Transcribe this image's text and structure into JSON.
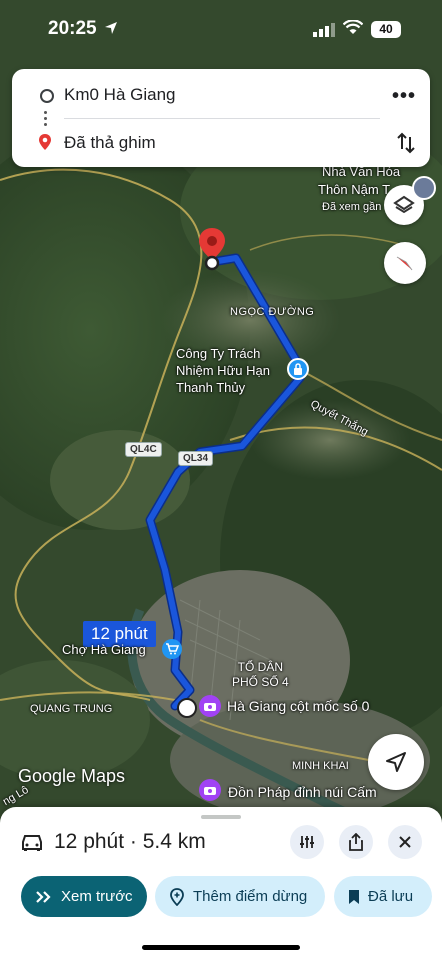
{
  "status_bar": {
    "time": "20:25",
    "battery": "40"
  },
  "directions": {
    "origin": "Km0 Hà Giang",
    "destination": "Đã thả ghim"
  },
  "map": {
    "labels": {
      "nha_van_hoa": "Nhà Văn Hóa",
      "thon_nam": "Thôn Nậm T",
      "da_xem_gan": "Đã xem gần",
      "ngoc_duong": "NGỌC ĐƯỜNG",
      "company_line1": "Công Ty Trách",
      "company_line2": "Nhiệm Hữu Hạn",
      "company_line3": "Thanh Thủy",
      "quyet_thang": "Quyết Thắng",
      "cho_ha_giang": "Chợ Hà Giang",
      "to_dan_line1": "TỔ DÂN",
      "to_dan_line2": "PHỐ SỐ 4",
      "cot_moc": "Hà Giang cột mốc số 0",
      "quang_trung": "QUANG TRUNG",
      "minh_khai": "MINH KHAI",
      "don_phap": "Đồn Pháp đỉnh núi Cấm",
      "ng_lo": "ng Lô"
    },
    "road_shields": {
      "ql4c": "QL4C",
      "ql34": "QL34"
    },
    "eta_badge": "12 phút",
    "attribution": "Google Maps",
    "colors": {
      "route": "#1a56db",
      "route_outline": "#0b2e8a",
      "pin": "#e53935",
      "poi_purple": "#a142f4",
      "poi_blue": "#2196f3"
    }
  },
  "sheet": {
    "summary": "12 phút · 5.4 km",
    "buttons": {
      "preview": "Xem trước",
      "add_stop": "Thêm điểm dừng",
      "saved": "Đã lưu"
    }
  }
}
